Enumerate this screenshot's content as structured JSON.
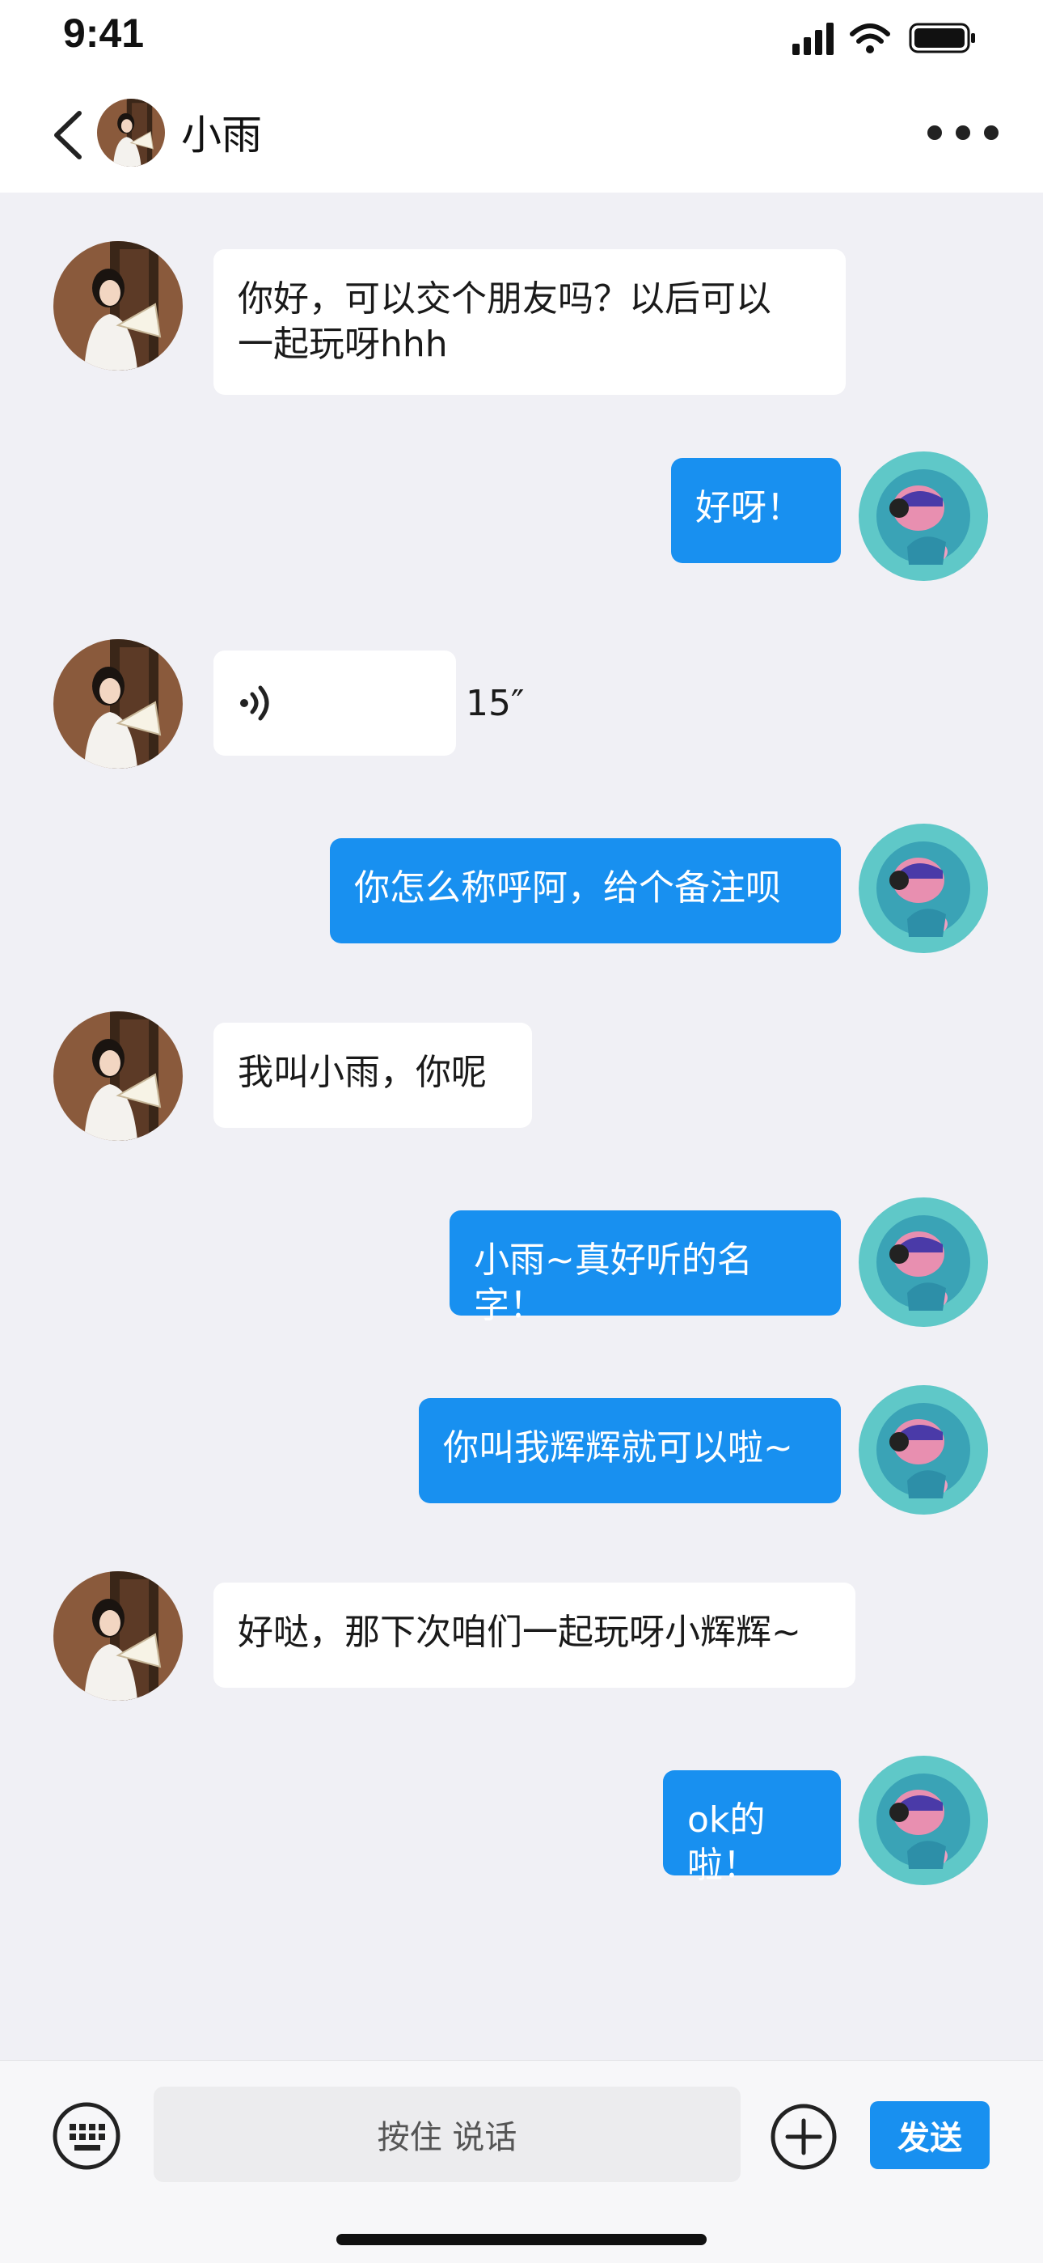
{
  "status_bar": {
    "time": "9:41",
    "icons": [
      "signal-icon",
      "wifi-icon",
      "battery-icon"
    ]
  },
  "header": {
    "title": "小雨",
    "back_icon": "chevron-left-icon",
    "more_icon": "more-dots-icon"
  },
  "messages": [
    {
      "side": "in",
      "type": "text",
      "text": "你好，可以交个朋友吗？以后可以\n一起玩呀hhh"
    },
    {
      "side": "out",
      "type": "text",
      "text": "好呀！"
    },
    {
      "side": "in",
      "type": "voice",
      "duration": "15″"
    },
    {
      "side": "out",
      "type": "text",
      "text": "你怎么称呼阿，给个备注呗"
    },
    {
      "side": "in",
      "type": "text",
      "text": "我叫小雨，你呢"
    },
    {
      "side": "out",
      "type": "text",
      "text": "小雨~真好听的名字！"
    },
    {
      "side": "out",
      "type": "text",
      "text": "你叫我辉辉就可以啦~"
    },
    {
      "side": "in",
      "type": "text",
      "text": "好哒，那下次咱们一起玩呀小辉辉~"
    },
    {
      "side": "out",
      "type": "text",
      "text": "ok的啦！"
    }
  ],
  "input_bar": {
    "voice_placeholder": "按住 说话",
    "send_label": "发送",
    "keyboard_icon": "keyboard-icon",
    "plus_icon": "plus-circle-icon"
  },
  "colors": {
    "accent": "#1890f0",
    "chat_bg": "#f0f0f5",
    "bubble_in": "#ffffff"
  }
}
